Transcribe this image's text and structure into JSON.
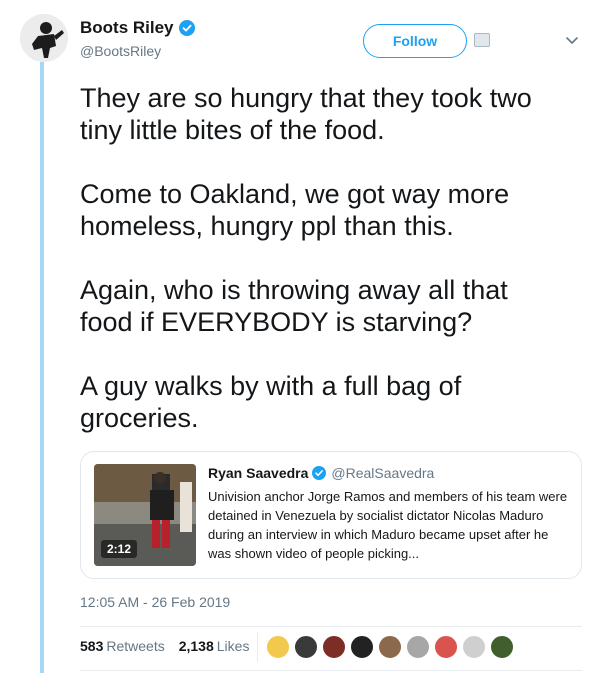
{
  "user": {
    "display_name": "Boots Riley",
    "handle": "@BootsRiley",
    "follow_label": "Follow"
  },
  "tweet": {
    "paragraphs": [
      "They are so hungry that they took two\ntiny little bites of the food.",
      "Come to Oakland, we got way more\nhomeless, hungry ppl than this.",
      "Again, who is throwing away all that\nfood if EVERYBODY is starving?",
      "A guy walks by with a full bag of\ngroceries."
    ],
    "timestamp": "12:05 AM - 26 Feb 2019"
  },
  "quote": {
    "display_name": "Ryan Saavedra",
    "handle": "@RealSaavedra",
    "text": "Univision anchor Jorge Ramos and members of his team were detained in Venezuela by socialist dictator Nicolas Maduro during an interview in which Maduro became upset after he was shown video of people picking...",
    "video_duration": "2:12"
  },
  "stats": {
    "retweets_count": "583",
    "retweets_label": "Retweets",
    "likes_count": "2,138",
    "likes_label": "Likes"
  },
  "colors": {
    "accent": "#1da1f2",
    "thread_line": "#a4d9f5",
    "secondary_text": "#657786"
  },
  "icons": [
    "verified-badge-icon",
    "chevron-down-icon",
    "follow-badge-icon"
  ],
  "likers": [
    {
      "color": "#f2c94c"
    },
    {
      "color": "#3a3a3a"
    },
    {
      "color": "#7b2d26"
    },
    {
      "color": "#222222"
    },
    {
      "color": "#8a6a4a"
    },
    {
      "color": "#a7a7a7"
    },
    {
      "color": "#d9534f"
    },
    {
      "color": "#cfcfcf"
    },
    {
      "color": "#3f5f2f"
    }
  ]
}
